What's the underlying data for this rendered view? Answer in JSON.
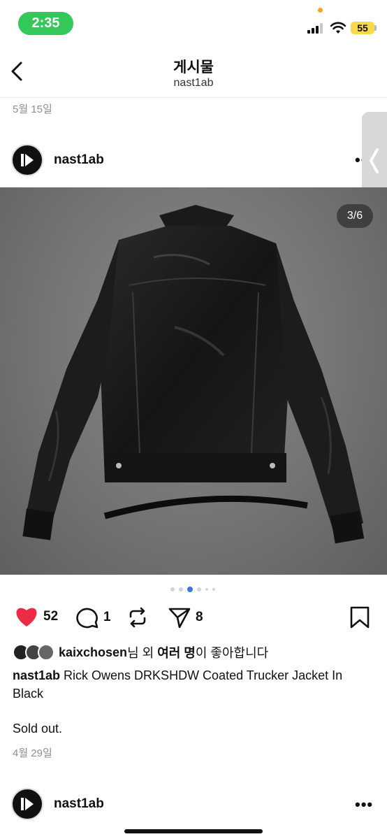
{
  "status_bar": {
    "time": "2:35",
    "battery": "55"
  },
  "header": {
    "title": "게시물",
    "subtitle": "nast1ab"
  },
  "previous_post": {
    "date": "5월 15일"
  },
  "post": {
    "username": "nast1ab",
    "more": "•••",
    "image_counter": "3/6",
    "carousel": {
      "total_visible_dots": 6,
      "active_index": 2
    },
    "actions": {
      "likes": "52",
      "comments": "1",
      "shares": "8"
    },
    "liked_by": {
      "user": "kaixchosen",
      "suffix_1": "님 외 ",
      "bold": "여러 명",
      "suffix_2": "이 좋아합니다"
    },
    "caption": {
      "username": "nast1ab",
      "text": " Rick Owens DRKSHDW Coated Trucker Jacket In Black",
      "extra": "Sold out."
    },
    "date": "4월 29일"
  },
  "next_post": {
    "username": "nast1ab",
    "more": "•••"
  },
  "colors": {
    "status_green": "#34c759",
    "like_red": "#ed2b45",
    "carousel_active": "#3c78e6",
    "battery_yellow": "#f7d94c"
  }
}
